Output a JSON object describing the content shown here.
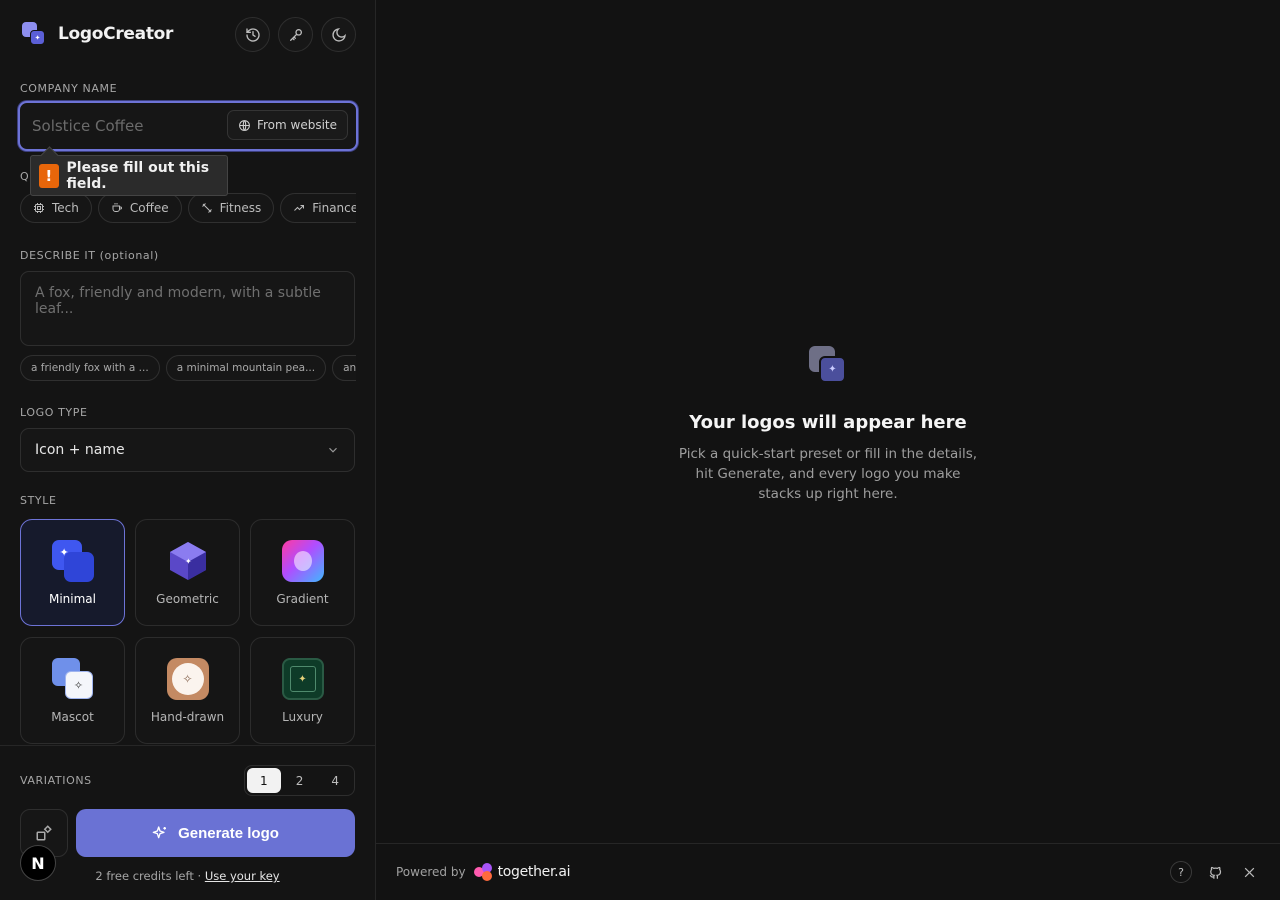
{
  "app": {
    "name": "LogoCreator"
  },
  "header": {
    "history_icon": "history-icon",
    "key_icon": "key-icon",
    "theme_icon": "moon-icon"
  },
  "company": {
    "label": "COMPANY NAME",
    "placeholder": "Solstice Coffee",
    "from_website_label": "From website",
    "validation_message": "Please fill out this field."
  },
  "quick_start": {
    "label_partial": "Q",
    "chips": [
      "Tech",
      "Coffee",
      "Fitness",
      "Finance"
    ]
  },
  "describe": {
    "label": "DESCRIBE IT (optional)",
    "placeholder": "A fox, friendly and modern, with a subtle leaf...",
    "suggestions": [
      "a friendly fox with a ...",
      "a minimal mountain pea...",
      "an abs"
    ]
  },
  "logo_type": {
    "label": "LOGO TYPE",
    "selected": "Icon + name"
  },
  "style": {
    "label": "STYLE",
    "options": [
      "Minimal",
      "Geometric",
      "Gradient",
      "Mascot",
      "Hand-drawn",
      "Luxury"
    ],
    "selected": "Minimal"
  },
  "variations": {
    "label": "VARIATIONS",
    "options": [
      "1",
      "2",
      "4"
    ],
    "selected": "1"
  },
  "generate": {
    "label": "Generate logo"
  },
  "credits": {
    "text": "2 free credits left · ",
    "link": "Use your key"
  },
  "empty_state": {
    "title": "Your logos will appear here",
    "text": "Pick a quick-start preset or fill in the details, hit Generate, and every logo you make stacks up right here."
  },
  "footer": {
    "powered_by": "Powered by",
    "brand": "together.ai"
  },
  "colors": {
    "accent": "#6a72d4",
    "background": "#121212",
    "warning": "#e8660a"
  }
}
